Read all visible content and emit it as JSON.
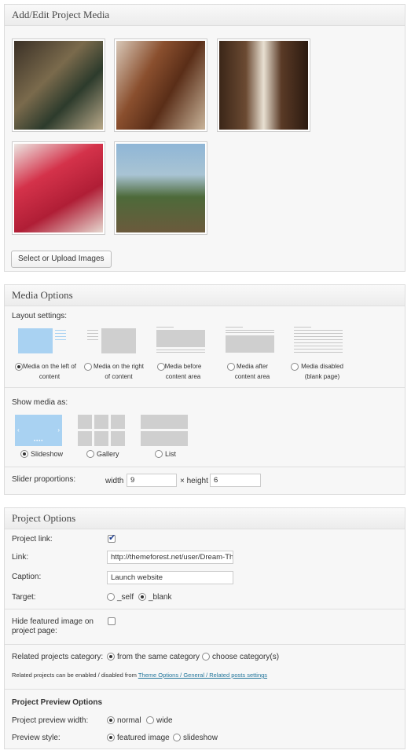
{
  "media_panel": {
    "title": "Add/Edit Project Media",
    "upload_button": "Select or Upload Images"
  },
  "media_options": {
    "title": "Media Options",
    "layout_label": "Layout settings:",
    "layouts": [
      {
        "label": "Media on the left of content"
      },
      {
        "label": "Media on the right of content"
      },
      {
        "label": "Media before content area"
      },
      {
        "label": "Media after content area"
      },
      {
        "label": "Media disabled (blank page)"
      }
    ],
    "show_label": "Show media as:",
    "show_options": [
      "Slideshow",
      "Gallery",
      "List"
    ],
    "proportions_label": "Slider proportions:",
    "width_label": "width",
    "width_value": "9",
    "height_label": "× height",
    "height_value": "6"
  },
  "project_options": {
    "title": "Project Options",
    "project_link_label": "Project link:",
    "link_label": "Link:",
    "link_value": "http://themeforest.net/user/Dream-Th",
    "caption_label": "Caption:",
    "caption_value": "Launch website",
    "target_label": "Target:",
    "target_self": "_self",
    "target_blank": "_blank",
    "hide_featured_label": "Hide featured image on project page:",
    "related_label": "Related projects category:",
    "related_same": "from the same category",
    "related_choose": "choose category(s)",
    "related_note": "Related projects can be enabled / disabled from",
    "related_note_link": "Theme Options / General / Related posts settings",
    "preview_heading": "Project Preview Options",
    "preview_width_label": "Project preview width:",
    "preview_normal": "normal",
    "preview_wide": "wide",
    "preview_style_label": "Preview style:",
    "preview_featured": "featured image",
    "preview_slideshow": "slideshow"
  }
}
